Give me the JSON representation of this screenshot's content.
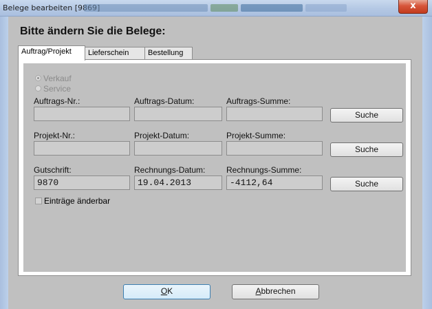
{
  "window": {
    "title": "Belege bearbeiten [9869]",
    "close_glyph": "x"
  },
  "heading": "Bitte ändern Sie die Belege:",
  "tabs": [
    {
      "label": "Auftrag/Projekt",
      "active": true
    },
    {
      "label": "Lieferschein",
      "active": false
    },
    {
      "label": "Bestellung",
      "active": false
    }
  ],
  "radios": [
    {
      "label": "Verkauf",
      "checked": true,
      "enabled": false
    },
    {
      "label": "Service",
      "checked": false,
      "enabled": false
    }
  ],
  "rows": [
    {
      "nr_label": "Auftrags-Nr.:",
      "nr_value": "",
      "datum_label": "Auftrags-Datum:",
      "datum_value": "",
      "summe_label": "Auftrags-Summe:",
      "summe_value": "",
      "button": "Suche"
    },
    {
      "nr_label": "Projekt-Nr.:",
      "nr_value": "",
      "datum_label": "Projekt-Datum:",
      "datum_value": "",
      "summe_label": "Projekt-Summe:",
      "summe_value": "",
      "button": "Suche"
    },
    {
      "nr_label": "Gutschrift:",
      "nr_value": "9870",
      "datum_label": "Rechnungs-Datum:",
      "datum_value": "19.04.2013",
      "summe_label": "Rechnungs-Summe:",
      "summe_value": "-4112,64",
      "button": "Suche"
    }
  ],
  "checkbox": {
    "label": "Einträge änderbar",
    "checked": false
  },
  "footer": {
    "ok_first": "O",
    "ok_rest": "K",
    "cancel_first": "A",
    "cancel_rest": "bbrechen"
  },
  "colors": {
    "dialog_bg": "#c0c0c0",
    "field_bg": "#cdcdcd",
    "titlebar": "#b4c8e4",
    "close_button": "#c23b1e"
  }
}
